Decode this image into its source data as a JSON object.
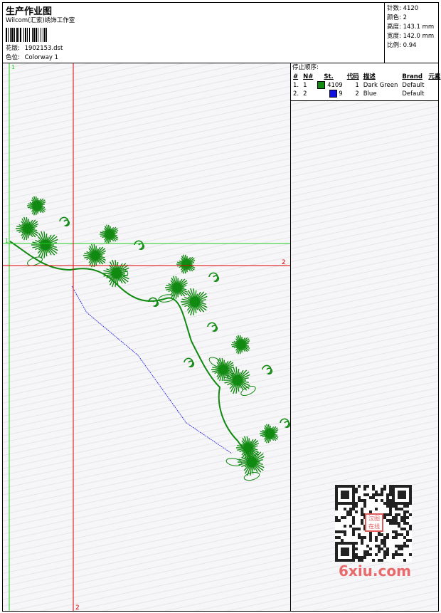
{
  "header": {
    "title": "生产作业图",
    "company": "Wilcom(汇索)绣饰工作室",
    "design_label": "花版:",
    "design_value": "1902153.dst",
    "colorway_label": "色位:",
    "colorway_value": "Colorway 1"
  },
  "stats": [
    {
      "label": "针数:",
      "value": "4120"
    },
    {
      "label": "颜色:",
      "value": "2"
    },
    {
      "label": "高度:",
      "value": "143.1 mm"
    },
    {
      "label": "宽度:",
      "value": "142.0 mm"
    },
    {
      "label": "比例:",
      "value": "0.94"
    }
  ],
  "stop_sequence": {
    "heading": "停止顺序:",
    "columns": [
      "#",
      "N#",
      "St.",
      "代码",
      "描述",
      "Brand",
      "元素"
    ],
    "rows": [
      {
        "index": "1.",
        "n": "1",
        "color": "#118a11",
        "stitches": "4109",
        "code": "1",
        "desc": "Dark Green",
        "brand": "Default",
        "element": ""
      },
      {
        "index": "2.",
        "n": "2",
        "color": "#1010e0",
        "stitches": "9",
        "code": "2",
        "desc": "Blue",
        "brand": "Default",
        "element": ""
      }
    ]
  },
  "canvas": {
    "marker_green_1": "1",
    "marker_green_1b": "1",
    "marker_red_2": "2",
    "marker_red_2b": "2",
    "colors": {
      "green": "#118a11",
      "red": "#e00000",
      "blue": "#1010e0",
      "guide_green": "#22cc22"
    }
  },
  "watermark": {
    "text": "6xiu.com",
    "seal_text": "汉图在线"
  }
}
